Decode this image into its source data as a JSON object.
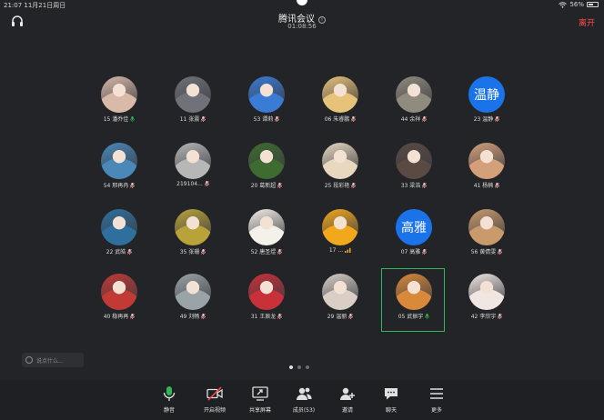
{
  "status": {
    "time_date": "21:07  11月21日周日",
    "battery": "56%",
    "battery_level": 0.56
  },
  "header": {
    "title": "腾讯会议",
    "timer": "01:08:56",
    "leave_label": "离开"
  },
  "participants": [
    {
      "name": "15 潘乔佳",
      "avatar": "photo",
      "color": "#d9b9a8",
      "mic": "on"
    },
    {
      "name": "11 张震",
      "avatar": "photo",
      "color": "#6f7279",
      "mic": "muted"
    },
    {
      "name": "53 谭莉",
      "avatar": "photo",
      "color": "#3a7bd5",
      "mic": "muted"
    },
    {
      "name": "06 朱睿鹏",
      "avatar": "photo",
      "color": "#e7c37a",
      "mic": "muted"
    },
    {
      "name": "44 余祥",
      "avatar": "photo",
      "color": "#8f8b7e",
      "mic": "muted"
    },
    {
      "name": "23 温静",
      "avatar": "text",
      "avatar_text": "温静",
      "color": "#1a73e8",
      "mic": "muted"
    },
    {
      "name": "54 邢再冉",
      "avatar": "photo",
      "color": "#4a88b8",
      "mic": "muted"
    },
    {
      "name": "219104...",
      "avatar": "photo",
      "color": "#b7b7b7",
      "mic": "muted"
    },
    {
      "name": "20 葛新超",
      "avatar": "photo",
      "color": "#3e6b2f",
      "mic": "muted"
    },
    {
      "name": "25 段彩艳",
      "avatar": "photo",
      "color": "#e8d8c0",
      "mic": "muted"
    },
    {
      "name": "33 梁浩",
      "avatar": "photo",
      "color": "#5a4a44",
      "mic": "muted"
    },
    {
      "name": "41 杨楠",
      "avatar": "photo",
      "color": "#d4a07a",
      "mic": "muted"
    },
    {
      "name": "22 武皓",
      "avatar": "photo",
      "color": "#2e6f9e",
      "mic": "muted"
    },
    {
      "name": "35 张珊",
      "avatar": "photo",
      "color": "#b8a23a",
      "mic": "muted"
    },
    {
      "name": "52 唐圣煜",
      "avatar": "photo",
      "color": "#f4f0ea",
      "mic": "muted"
    },
    {
      "name": "17 ...",
      "avatar": "photo",
      "color": "#f2a81d",
      "mic": "speaking"
    },
    {
      "name": "07 高雅",
      "avatar": "text",
      "avatar_text": "高雅",
      "color": "#1a73e8",
      "mic": "muted"
    },
    {
      "name": "56 黄倩雯",
      "avatar": "photo",
      "color": "#c99a6c",
      "mic": "muted"
    },
    {
      "name": "40 稳再再",
      "avatar": "photo",
      "color": "#c23a34",
      "mic": "muted"
    },
    {
      "name": "49 刘畅",
      "avatar": "photo",
      "color": "#9aa4a8",
      "mic": "muted"
    },
    {
      "name": "31 王辰龙",
      "avatar": "photo",
      "color": "#c8303a",
      "mic": "muted"
    },
    {
      "name": "29 温丽",
      "avatar": "photo",
      "color": "#d9cfc6",
      "mic": "muted"
    },
    {
      "name": "05 武振宇",
      "avatar": "photo",
      "color": "#d9893a",
      "mic": "on",
      "active": true
    },
    {
      "name": "42 李欣宇",
      "avatar": "photo",
      "color": "#f0e6e2",
      "mic": "muted"
    }
  ],
  "chat": {
    "placeholder": "说点什么..."
  },
  "pagination": {
    "pages": 3,
    "current": 1
  },
  "toolbar": {
    "mute": "静音",
    "video": "开启视频",
    "share": "共享屏幕",
    "members": "成员(53)",
    "invite": "邀请",
    "chat": "聊天",
    "more": "更多"
  },
  "colors": {
    "active_border": "#2fb75c",
    "leave": "#ff4d4f",
    "mic_on": "#2fb75c",
    "mic_muted": "#e0e0e0",
    "muted_slash": "#ff4d4f"
  }
}
